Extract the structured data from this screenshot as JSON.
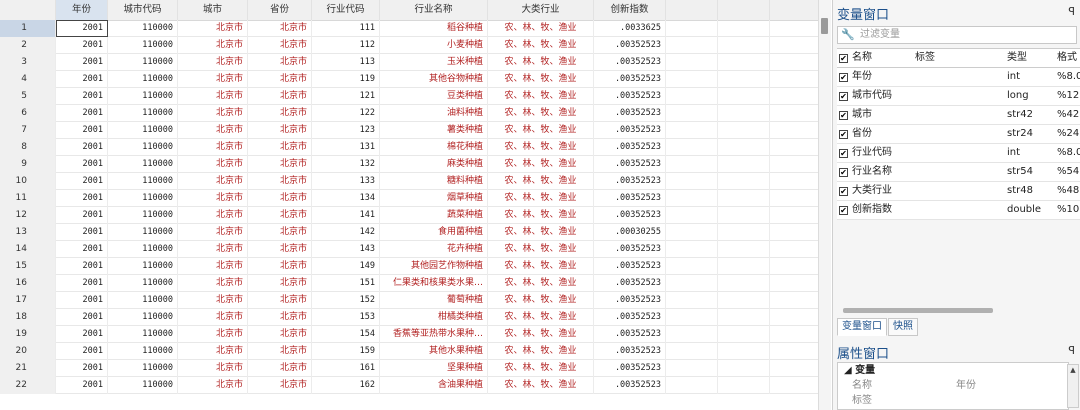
{
  "grid": {
    "columns": [
      {
        "label": "",
        "key": "rownum"
      },
      {
        "label": "年份",
        "key": "year"
      },
      {
        "label": "城市代码",
        "key": "city_code"
      },
      {
        "label": "城市",
        "key": "city"
      },
      {
        "label": "省份",
        "key": "province"
      },
      {
        "label": "行业代码",
        "key": "industry_code"
      },
      {
        "label": "行业名称",
        "key": "industry_name"
      },
      {
        "label": "大类行业",
        "key": "major_industry"
      },
      {
        "label": "创新指数",
        "key": "innovation_index"
      }
    ],
    "rows": [
      [
        "1",
        "2001",
        "110000",
        "北京市",
        "北京市",
        "111",
        "稻谷种植",
        "农、林、牧、渔业",
        ".0033625"
      ],
      [
        "2",
        "2001",
        "110000",
        "北京市",
        "北京市",
        "112",
        "小麦种植",
        "农、林、牧、渔业",
        ".00352523"
      ],
      [
        "3",
        "2001",
        "110000",
        "北京市",
        "北京市",
        "113",
        "玉米种植",
        "农、林、牧、渔业",
        ".00352523"
      ],
      [
        "4",
        "2001",
        "110000",
        "北京市",
        "北京市",
        "119",
        "其他谷物种植",
        "农、林、牧、渔业",
        ".00352523"
      ],
      [
        "5",
        "2001",
        "110000",
        "北京市",
        "北京市",
        "121",
        "豆类种植",
        "农、林、牧、渔业",
        ".00352523"
      ],
      [
        "6",
        "2001",
        "110000",
        "北京市",
        "北京市",
        "122",
        "油料种植",
        "农、林、牧、渔业",
        ".00352523"
      ],
      [
        "7",
        "2001",
        "110000",
        "北京市",
        "北京市",
        "123",
        "薯类种植",
        "农、林、牧、渔业",
        ".00352523"
      ],
      [
        "8",
        "2001",
        "110000",
        "北京市",
        "北京市",
        "131",
        "棉花种植",
        "农、林、牧、渔业",
        ".00352523"
      ],
      [
        "9",
        "2001",
        "110000",
        "北京市",
        "北京市",
        "132",
        "麻类种植",
        "农、林、牧、渔业",
        ".00352523"
      ],
      [
        "10",
        "2001",
        "110000",
        "北京市",
        "北京市",
        "133",
        "糖料种植",
        "农、林、牧、渔业",
        ".00352523"
      ],
      [
        "11",
        "2001",
        "110000",
        "北京市",
        "北京市",
        "134",
        "烟草种植",
        "农、林、牧、渔业",
        ".00352523"
      ],
      [
        "12",
        "2001",
        "110000",
        "北京市",
        "北京市",
        "141",
        "蔬菜种植",
        "农、林、牧、渔业",
        ".00352523"
      ],
      [
        "13",
        "2001",
        "110000",
        "北京市",
        "北京市",
        "142",
        "食用菌种植",
        "农、林、牧、渔业",
        ".00030255"
      ],
      [
        "14",
        "2001",
        "110000",
        "北京市",
        "北京市",
        "143",
        "花卉种植",
        "农、林、牧、渔业",
        ".00352523"
      ],
      [
        "15",
        "2001",
        "110000",
        "北京市",
        "北京市",
        "149",
        "其他园艺作物种植",
        "农、林、牧、渔业",
        ".00352523"
      ],
      [
        "16",
        "2001",
        "110000",
        "北京市",
        "北京市",
        "151",
        "仁果类和核果类水果…",
        "农、林、牧、渔业",
        ".00352523"
      ],
      [
        "17",
        "2001",
        "110000",
        "北京市",
        "北京市",
        "152",
        "葡萄种植",
        "农、林、牧、渔业",
        ".00352523"
      ],
      [
        "18",
        "2001",
        "110000",
        "北京市",
        "北京市",
        "153",
        "柑橘类种植",
        "农、林、牧、渔业",
        ".00352523"
      ],
      [
        "19",
        "2001",
        "110000",
        "北京市",
        "北京市",
        "154",
        "香蕉等亚热带水果种…",
        "农、林、牧、渔业",
        ".00352523"
      ],
      [
        "20",
        "2001",
        "110000",
        "北京市",
        "北京市",
        "159",
        "其他水果种植",
        "农、林、牧、渔业",
        ".00352523"
      ],
      [
        "21",
        "2001",
        "110000",
        "北京市",
        "北京市",
        "161",
        "坚果种植",
        "农、林、牧、渔业",
        ".00352523"
      ],
      [
        "22",
        "2001",
        "110000",
        "北京市",
        "北京市",
        "162",
        "含油果种植",
        "农、林、牧、渔业",
        ".00352523"
      ]
    ]
  },
  "var_window": {
    "title": "变量窗口",
    "pin": "ᵖ",
    "filter_placeholder": "过滤变量",
    "filter_icon": "wrench-icon",
    "headers": {
      "name": "名称",
      "label": "标签",
      "type": "类型",
      "format": "格式"
    },
    "vars": [
      {
        "name": "年份",
        "type": "int",
        "format": "%8.0"
      },
      {
        "name": "城市代码",
        "type": "long",
        "format": "%12"
      },
      {
        "name": "城市",
        "type": "str42",
        "format": "%42"
      },
      {
        "name": "省份",
        "type": "str24",
        "format": "%24"
      },
      {
        "name": "行业代码",
        "type": "int",
        "format": "%8.0"
      },
      {
        "name": "行业名称",
        "type": "str54",
        "format": "%54"
      },
      {
        "name": "大类行业",
        "type": "str48",
        "format": "%48"
      },
      {
        "name": "创新指数",
        "type": "double",
        "format": "%10"
      }
    ],
    "tabs": [
      "变量窗口",
      "快照"
    ]
  },
  "prop_window": {
    "title": "属性窗口",
    "pin": "ᵖ",
    "group": "变量",
    "rows": [
      {
        "key": "名称",
        "value": "年份"
      },
      {
        "key": "标签",
        "value": ""
      }
    ]
  }
}
